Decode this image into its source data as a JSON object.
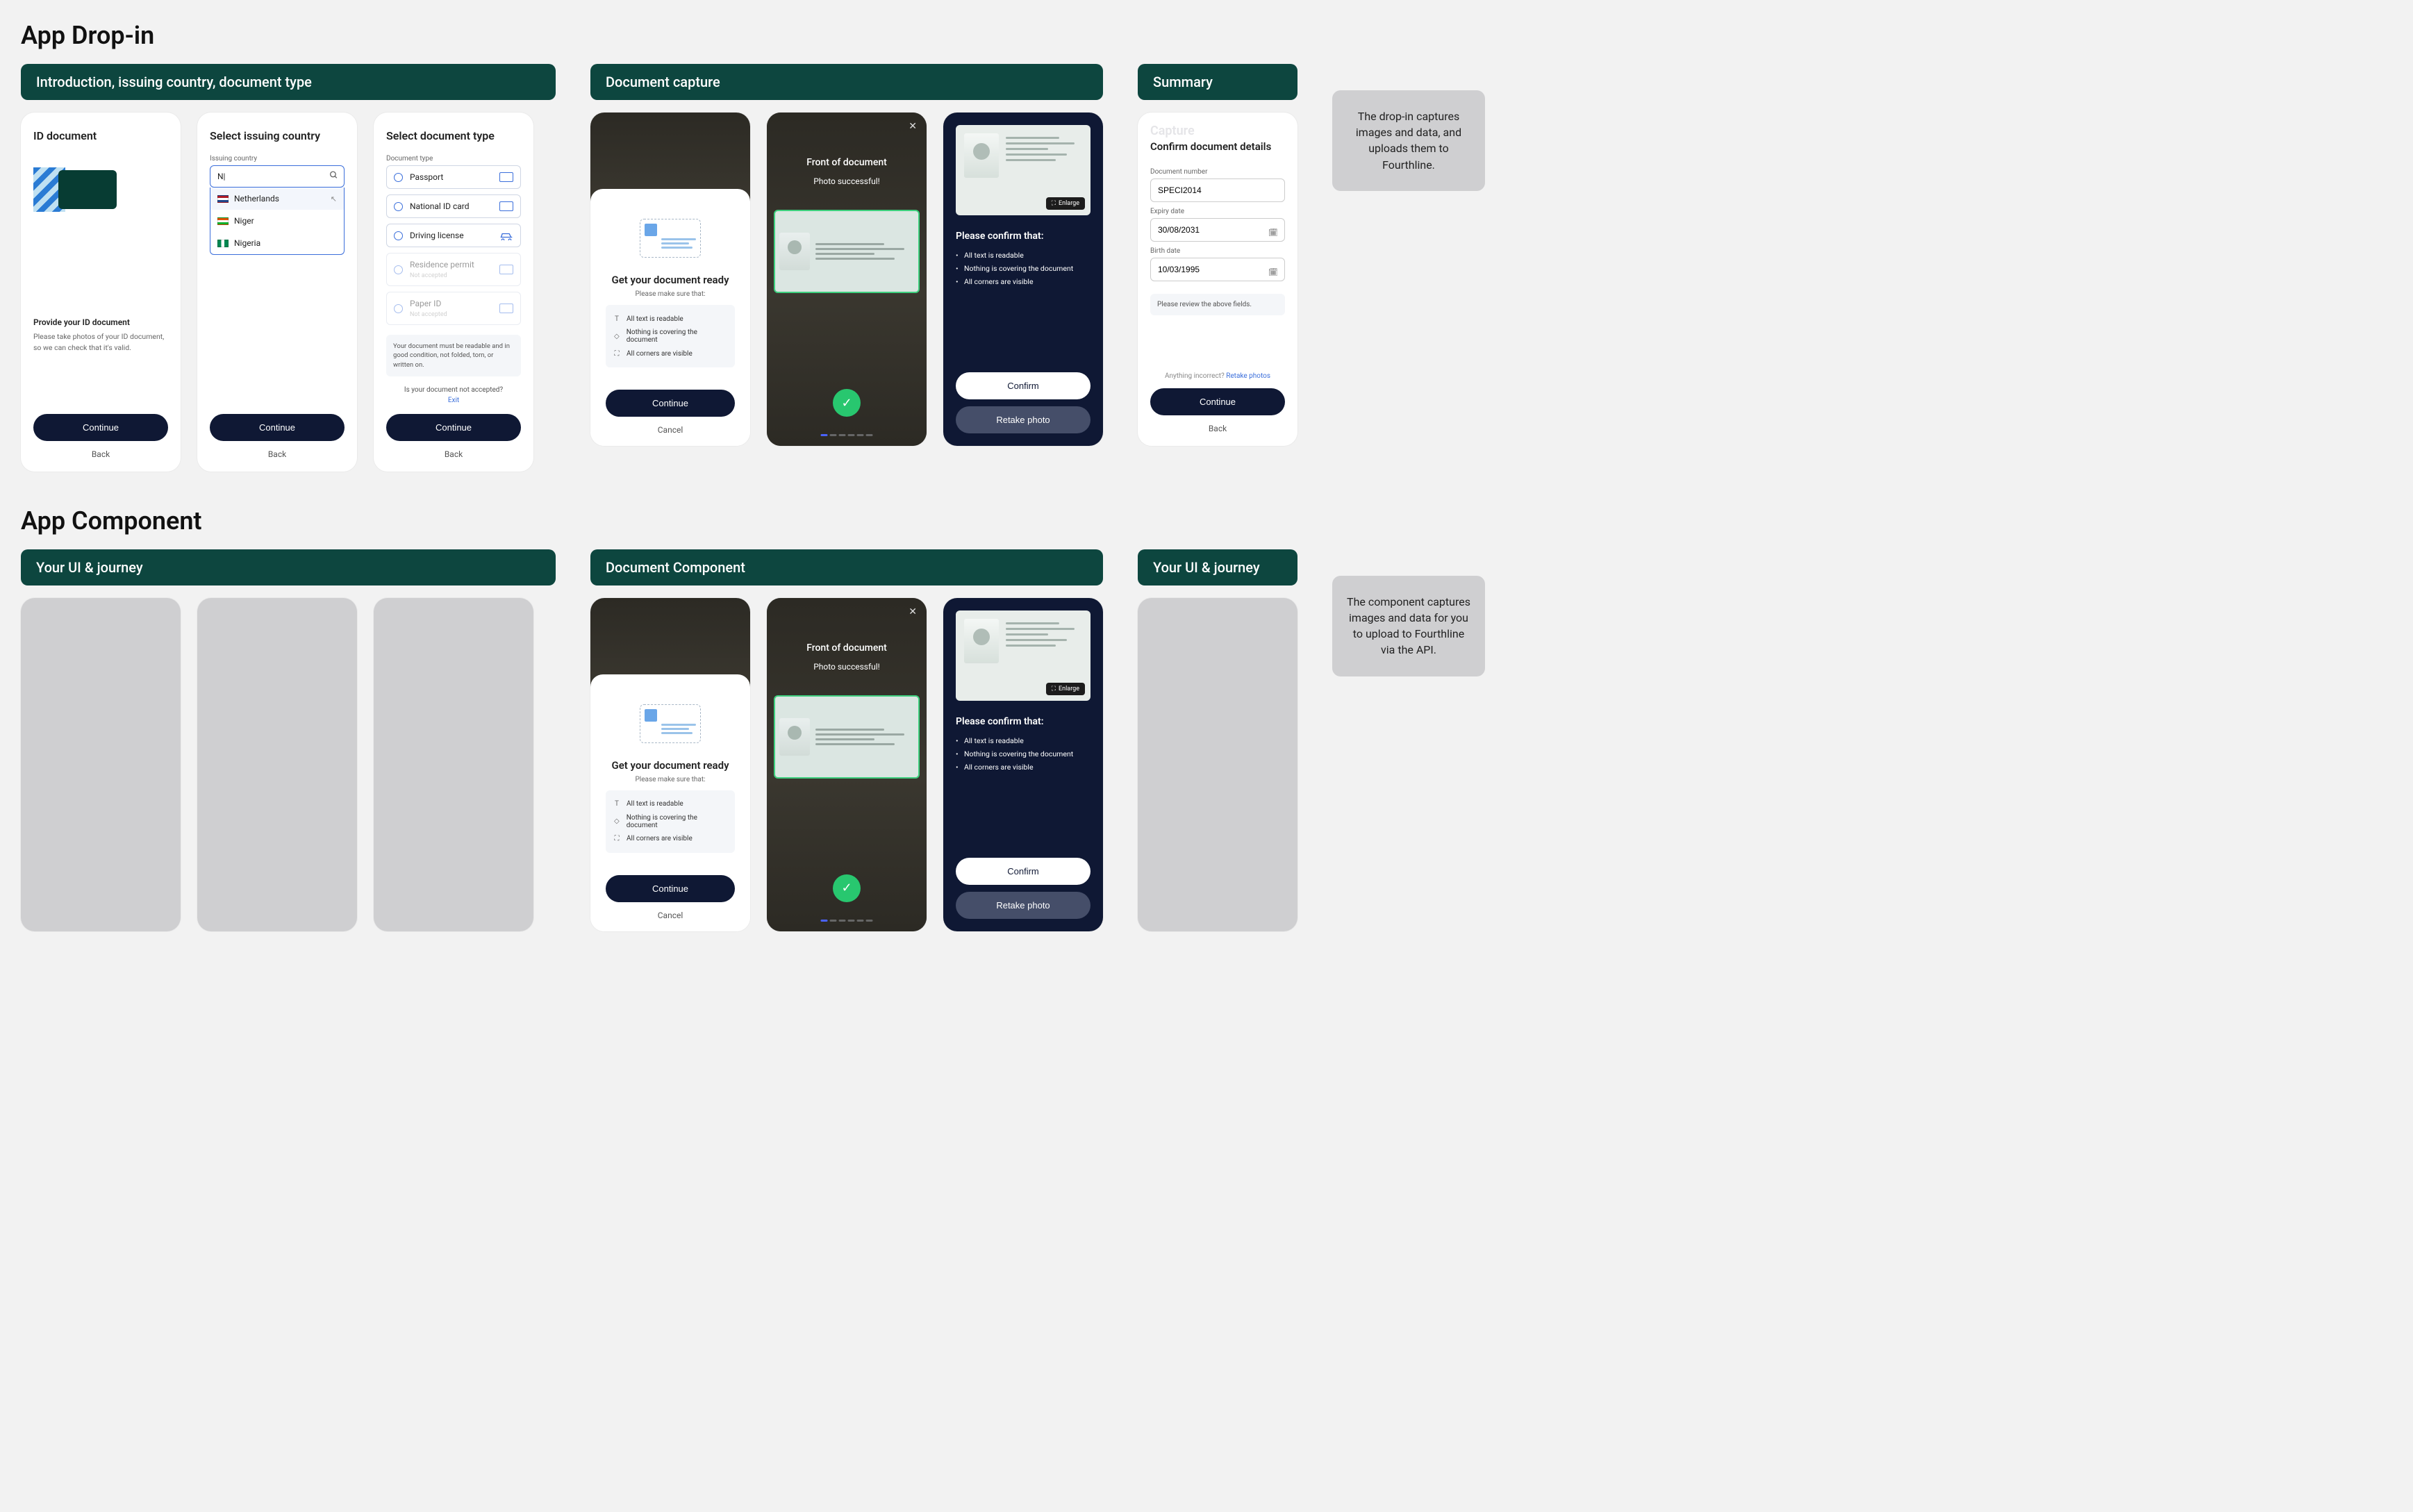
{
  "sections": {
    "dropin": {
      "title": "App Drop-in",
      "cluster1": {
        "header": "Introduction, issuing country, document type"
      },
      "cluster2": {
        "header": "Document capture"
      },
      "cluster3": {
        "header": "Summary"
      },
      "note": "The drop-in captures images and data, and uploads them to Fourthline."
    },
    "component": {
      "title": "App Component",
      "cluster1": {
        "header": "Your UI & journey"
      },
      "cluster2": {
        "header": "Document Component"
      },
      "cluster3": {
        "header": "Your UI & journey"
      },
      "note": "The component captures images and data for you to upload to Fourthline via the API."
    }
  },
  "common": {
    "continue": "Continue",
    "back": "Back",
    "cancel": "Cancel",
    "confirm": "Confirm",
    "retake": "Retake photo"
  },
  "screen_id": {
    "title": "ID document",
    "subhead": "Provide your ID document",
    "body": "Please take photos of your ID document, so we can check that it's valid."
  },
  "screen_country": {
    "title": "Select issuing country",
    "label": "Issuing country",
    "search_value": "N|",
    "items": [
      {
        "flag": "nl",
        "label": "Netherlands"
      },
      {
        "flag": "ne",
        "label": "Niger"
      },
      {
        "flag": "ng",
        "label": "Nigeria"
      }
    ]
  },
  "screen_doctype": {
    "title": "Select document type",
    "label": "Document type",
    "options": [
      {
        "label": "Passport",
        "enabled": true
      },
      {
        "label": "National ID card",
        "enabled": true
      },
      {
        "label": "Driving license",
        "enabled": true
      },
      {
        "label": "Residence permit",
        "sub": "Not accepted",
        "enabled": false
      },
      {
        "label": "Paper ID",
        "sub": "Not accepted",
        "enabled": false
      }
    ],
    "note": "Your document must be readable and in good condition, not folded, torn, or written on.",
    "not_accepted_q": "Is your document not accepted?",
    "exit": "Exit"
  },
  "screen_sheet": {
    "title": "Get your document ready",
    "sub": "Please make sure that:",
    "checks": [
      "All text is readable",
      "Nothing is covering the document",
      "All corners are visible"
    ]
  },
  "screen_capture": {
    "front": "Front of document",
    "success": "Photo successful!"
  },
  "screen_confirm": {
    "enlarge": "Enlarge",
    "title": "Please confirm that:",
    "checks": [
      "All text is readable",
      "Nothing is covering the document",
      "All corners are visible"
    ]
  },
  "screen_summary": {
    "ghost": "Capture",
    "title": "Confirm document details",
    "doc_num_label": "Document number",
    "doc_num": "SPECI2014",
    "expiry_label": "Expiry date",
    "expiry": "30/08/2031",
    "birth_label": "Birth date",
    "birth": "10/03/1995",
    "review": "Please review the above fields.",
    "incorrect": "Anything incorrect? ",
    "retake_link": "Retake photos"
  }
}
